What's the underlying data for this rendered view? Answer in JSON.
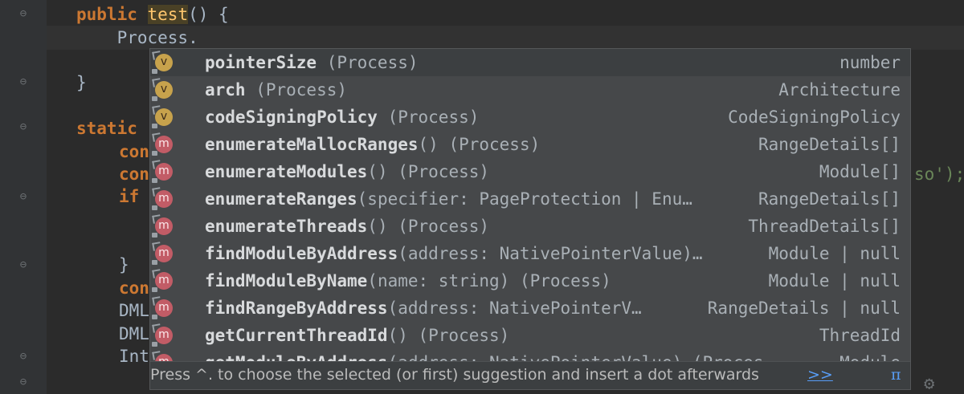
{
  "editor": {
    "lines": [
      {
        "id": "l1",
        "prefix": "",
        "kw": "public ",
        "fn": "test",
        "rest": "() {"
      },
      {
        "id": "l2",
        "text": "    Process."
      },
      {
        "id": "l3",
        "text": "}"
      },
      {
        "id": "l4",
        "kw": "static "
      },
      {
        "id": "l5",
        "kw": "con"
      },
      {
        "id": "l6",
        "kw": "con",
        "tail": "so');"
      },
      {
        "id": "l7",
        "kw": "if"
      },
      {
        "id": "l8",
        "text": "}"
      },
      {
        "id": "l9",
        "kw": "con"
      },
      {
        "id": "l10",
        "text": "DML"
      },
      {
        "id": "l11",
        "text": "DML"
      },
      {
        "id": "l12",
        "text": "Int"
      }
    ]
  },
  "autocomplete": {
    "items": [
      {
        "icon": "v",
        "name": "pointerSize",
        "params": " (Process)",
        "type": "number",
        "selected": true
      },
      {
        "icon": "v",
        "name": "arch",
        "params": " (Process)",
        "type": "Architecture"
      },
      {
        "icon": "v",
        "name": "codeSigningPolicy",
        "params": " (Process)",
        "type": "CodeSigningPolicy"
      },
      {
        "icon": "m",
        "name": "enumerateMallocRanges",
        "params": "() (Process)",
        "type": "RangeDetails[]"
      },
      {
        "icon": "m",
        "name": "enumerateModules",
        "params": "() (Process)",
        "type": "Module[]"
      },
      {
        "icon": "m",
        "name": "enumerateRanges",
        "params": "(specifier: PageProtection | Enu…",
        "type": "RangeDetails[]"
      },
      {
        "icon": "m",
        "name": "enumerateThreads",
        "params": "() (Process)",
        "type": "ThreadDetails[]"
      },
      {
        "icon": "m",
        "name": "findModuleByAddress",
        "params": "(address: NativePointerValue)…",
        "type": "Module | null"
      },
      {
        "icon": "m",
        "name": "findModuleByName",
        "params": "(name: string) (Process)",
        "type": "Module | null"
      },
      {
        "icon": "m",
        "name": "findRangeByAddress",
        "params": "(address: NativePointerV…",
        "type": "RangeDetails | null"
      },
      {
        "icon": "m",
        "name": "getCurrentThreadId",
        "params": "() (Process)",
        "type": "ThreadId"
      },
      {
        "icon": "m",
        "name": "getModuleByAddress",
        "params": "(address: NativePointerValue) (Proces…",
        "type": "Module"
      }
    ],
    "footer_hint": "Press ^. to choose the selected (or first) suggestion and insert a dot afterwards",
    "footer_more": ">>",
    "footer_pi": "π"
  },
  "colors": {
    "keyword": "#cc7832",
    "function": "#ffc66d",
    "popup_bg": "#46484a",
    "selected_bg": "#3c3f41",
    "method_icon": "#c25c66",
    "variable_icon": "#c7a24c",
    "link": "#589df6"
  },
  "icons": {
    "variable": "variable-icon",
    "method": "method-icon",
    "fold": "fold-marker-icon",
    "settings": "gear-icon"
  }
}
